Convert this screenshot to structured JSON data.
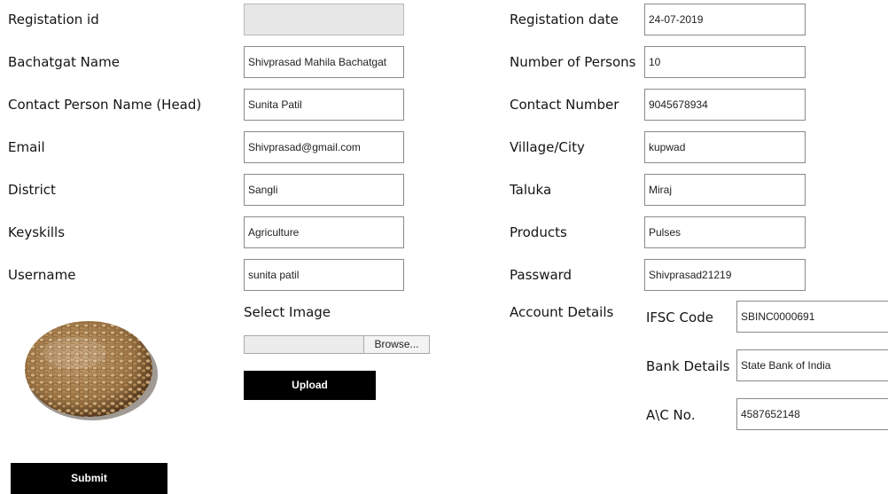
{
  "form": {
    "left": [
      {
        "key": "registration_id",
        "label": "Registation id",
        "value": ""
      },
      {
        "key": "bachatgat_name",
        "label": "Bachatgat Name",
        "value": "Shivprasad Mahila Bachatgat"
      },
      {
        "key": "contact_person",
        "label": "Contact Person Name  (Head)",
        "value": "Sunita Patil"
      },
      {
        "key": "email",
        "label": "Email",
        "value": "Shivprasad@gmail.com"
      },
      {
        "key": "district",
        "label": "District",
        "value": "Sangli"
      },
      {
        "key": "keyskills",
        "label": "Keyskills",
        "value": "Agriculture"
      },
      {
        "key": "username",
        "label": "Username",
        "value": "sunita patil"
      }
    ],
    "right": [
      {
        "key": "registration_date",
        "label": "Registation date",
        "value": "24-07-2019"
      },
      {
        "key": "number_of_persons",
        "label": "Number of Persons",
        "value": "10"
      },
      {
        "key": "contact_number",
        "label": "Contact Number",
        "value": "9045678934"
      },
      {
        "key": "village_city",
        "label": "Village/City",
        "value": "kupwad"
      },
      {
        "key": "taluka",
        "label": "Taluka",
        "value": "Miraj"
      },
      {
        "key": "products",
        "label": "Products",
        "value": "Pulses"
      },
      {
        "key": "password",
        "label": "Passward",
        "value": "Shivprasad21219"
      }
    ]
  },
  "image_upload": {
    "select_label": "Select Image",
    "browse_label": "Browse...",
    "upload_label": "Upload",
    "thumbnail_icon": "pulses-bowl-image"
  },
  "account": {
    "title": "Account Details",
    "ifsc_label": "IFSC Code",
    "ifsc_value": "SBINC0000691",
    "bank_label": "Bank Details",
    "bank_value": "State Bank of India",
    "ac_label": "A\\C No.",
    "ac_value": "4587652148"
  },
  "submit_label": "Submit",
  "colors": {
    "button_bg": "#000000",
    "button_text": "#ffffff",
    "disabled_field": "#e7e7e7",
    "field_border": "#8a8a8a"
  }
}
